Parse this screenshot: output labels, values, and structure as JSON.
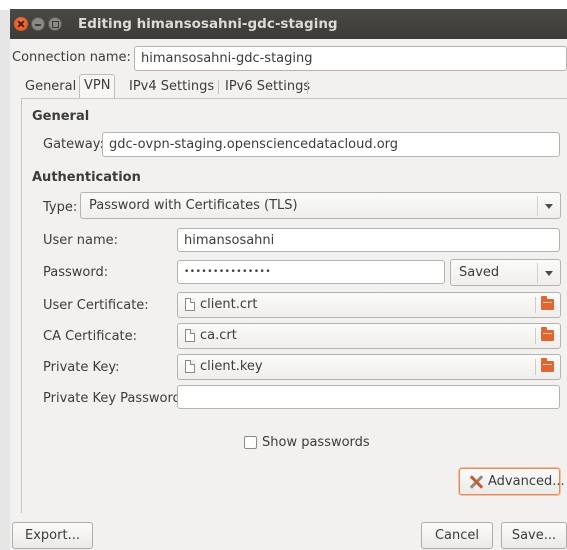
{
  "window": {
    "title": "Editing himansosahni-gdc-staging"
  },
  "connection": {
    "label": "Connection name:",
    "value": "himansosahni-gdc-staging"
  },
  "tabs": [
    {
      "label": "General"
    },
    {
      "label": "VPN"
    },
    {
      "label": "IPv4 Settings"
    },
    {
      "label": "IPv6 Settings"
    }
  ],
  "general": {
    "heading": "General",
    "gateway_label": "Gateway:",
    "gateway_value": "gdc-ovpn-staging.opensciencedatacloud.org"
  },
  "auth": {
    "heading": "Authentication",
    "type_label": "Type:",
    "type_value": "Password with Certificates (TLS)",
    "username_label": "User name:",
    "username_value": "himansosahni",
    "password_label": "Password:",
    "password_value": "•••••••••••••••",
    "password_storage": "Saved",
    "user_cert_label": "User Certificate:",
    "user_cert_value": "client.crt",
    "ca_cert_label": "CA Certificate:",
    "ca_cert_value": "ca.crt",
    "private_key_label": "Private Key:",
    "private_key_value": "client.key",
    "private_key_password_label": "Private Key Password:",
    "private_key_password_value": "",
    "show_passwords_label": "Show passwords"
  },
  "buttons": {
    "advanced": "Advanced...",
    "export": "Export...",
    "cancel": "Cancel",
    "save": "Save..."
  },
  "icons": {
    "tools": "tools-icon",
    "file": "document-icon",
    "folder": "folder-icon"
  }
}
